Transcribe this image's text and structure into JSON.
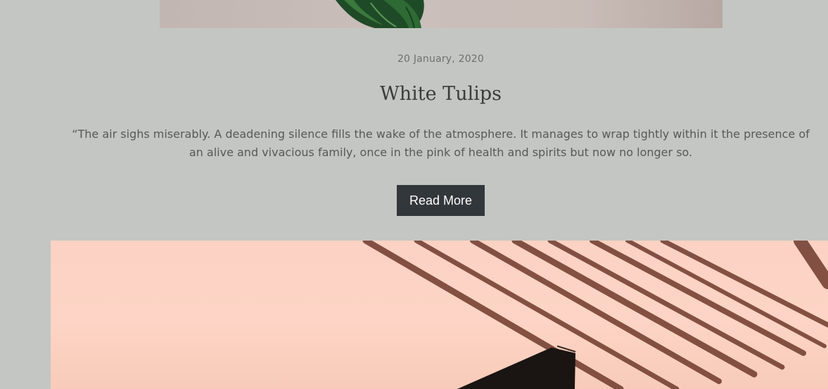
{
  "post": {
    "date": "20 January, 2020",
    "title": "White Tulips",
    "excerpt": "“The air sighs miserably. A deadening silence fills the wake of the atmosphere. It manages to wrap tightly within it the presence of an alive and vivacious family, once in the pink of health and spirits but now no longer so.",
    "read_more_label": "Read More"
  },
  "images": {
    "top": "plant-photo",
    "bottom": "palm-shadow-photo"
  },
  "colors": {
    "background": "#c4c6c3",
    "button": "#32373c",
    "title": "#3a3c3d",
    "text": "#575958"
  }
}
